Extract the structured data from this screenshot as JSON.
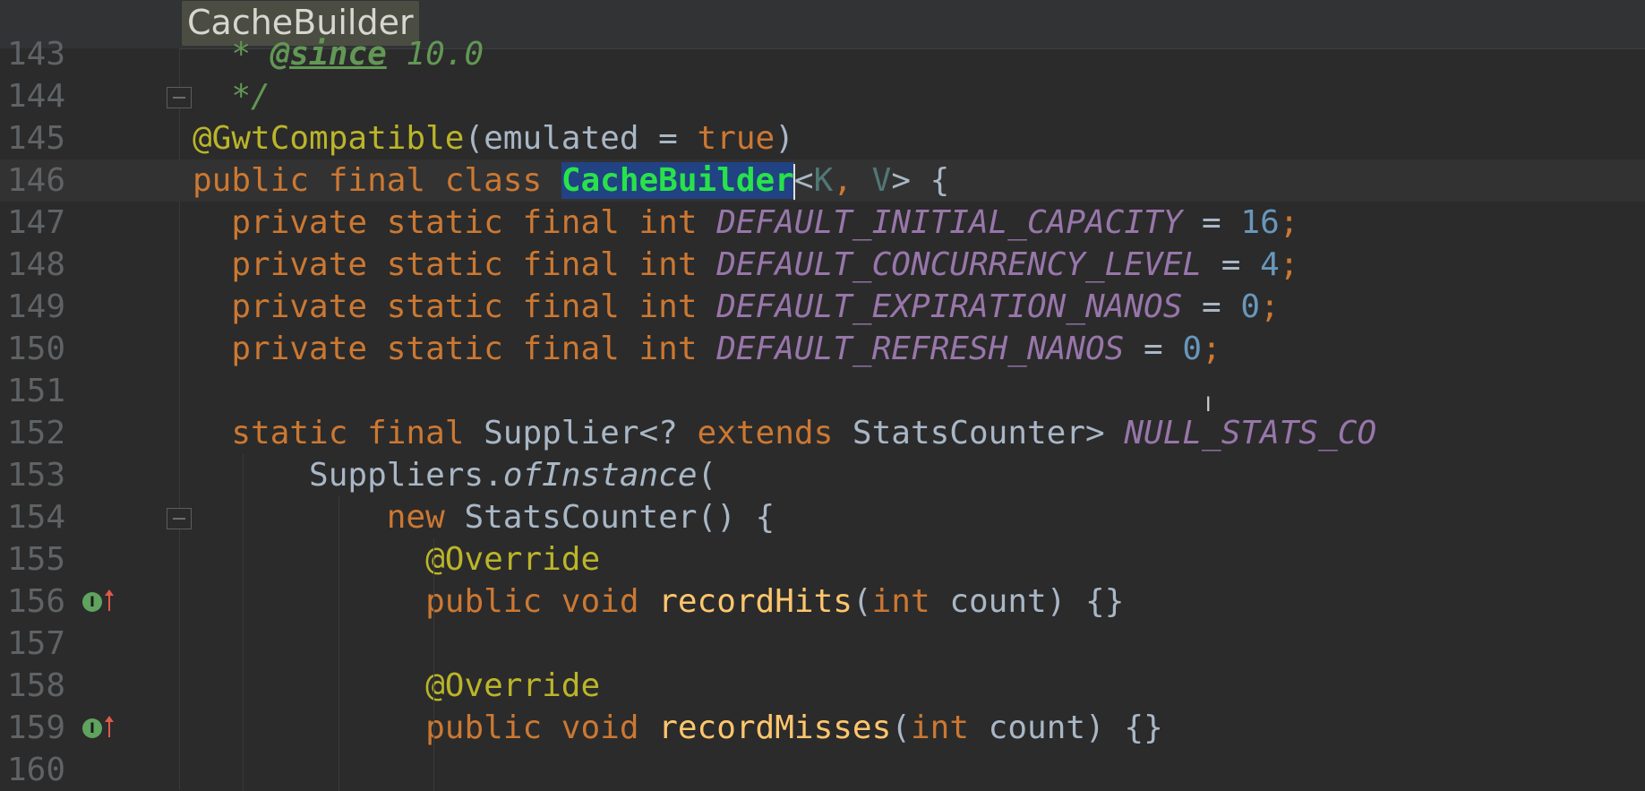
{
  "breadcrumb": {
    "label": "CacheBuilder"
  },
  "lines": [
    {
      "n": "143",
      "parts": [
        {
          "t": "  * ",
          "c": "cmt"
        },
        {
          "t": "@since",
          "c": "cmt-tag"
        },
        {
          "t": " 10.0",
          "c": "cmt"
        }
      ]
    },
    {
      "n": "144",
      "parts": [
        {
          "t": "  */",
          "c": "cmt"
        }
      ]
    },
    {
      "n": "145",
      "parts": [
        {
          "t": "@GwtCompatible",
          "c": "ann"
        },
        {
          "t": "(emulated = ",
          "c": ""
        },
        {
          "t": "true",
          "c": "kw"
        },
        {
          "t": ")",
          "c": ""
        }
      ]
    },
    {
      "n": "146",
      "parts": [
        {
          "t": "public final class ",
          "c": "kw"
        },
        {
          "t": "CacheBuilder",
          "c": "hl-cls"
        },
        {
          "t": "|",
          "c": "caret"
        },
        {
          "t": "<",
          "c": ""
        },
        {
          "t": "K",
          "c": "typeparam"
        },
        {
          "t": ", ",
          "c": "kw"
        },
        {
          "t": "V",
          "c": "typeparam"
        },
        {
          "t": "> {",
          "c": ""
        }
      ]
    },
    {
      "n": "147",
      "parts": [
        {
          "t": "  private static final int ",
          "c": "kw"
        },
        {
          "t": "DEFAULT_INITIAL_CAPACITY",
          "c": "fld"
        },
        {
          "t": " = ",
          "c": ""
        },
        {
          "t": "16",
          "c": "num"
        },
        {
          "t": ";",
          "c": "kw"
        }
      ]
    },
    {
      "n": "148",
      "parts": [
        {
          "t": "  private static final int ",
          "c": "kw"
        },
        {
          "t": "DEFAULT_CONCURRENCY_LEVEL",
          "c": "fld"
        },
        {
          "t": " = ",
          "c": ""
        },
        {
          "t": "4",
          "c": "num"
        },
        {
          "t": ";",
          "c": "kw"
        }
      ]
    },
    {
      "n": "149",
      "parts": [
        {
          "t": "  private static final int ",
          "c": "kw"
        },
        {
          "t": "DEFAULT_EXPIRATION_NANOS",
          "c": "fld"
        },
        {
          "t": " = ",
          "c": ""
        },
        {
          "t": "0",
          "c": "num"
        },
        {
          "t": ";",
          "c": "kw"
        }
      ]
    },
    {
      "n": "150",
      "parts": [
        {
          "t": "  private static final int ",
          "c": "kw"
        },
        {
          "t": "DEFAULT_REFRESH_NANOS",
          "c": "fld"
        },
        {
          "t": " = ",
          "c": ""
        },
        {
          "t": "0",
          "c": "num"
        },
        {
          "t": ";",
          "c": "kw"
        }
      ]
    },
    {
      "n": "151",
      "parts": []
    },
    {
      "n": "152",
      "parts": [
        {
          "t": "  static final ",
          "c": "kw"
        },
        {
          "t": "Supplier<? ",
          "c": ""
        },
        {
          "t": "extends ",
          "c": "kw"
        },
        {
          "t": "StatsCounter> ",
          "c": ""
        },
        {
          "t": "NULL_STATS_CO",
          "c": "fld"
        }
      ]
    },
    {
      "n": "153",
      "parts": [
        {
          "t": "      Suppliers.",
          "c": ""
        },
        {
          "t": "ofInstance",
          "c": "ital"
        },
        {
          "t": "(",
          "c": ""
        }
      ]
    },
    {
      "n": "154",
      "parts": [
        {
          "t": "          ",
          "c": ""
        },
        {
          "t": "new ",
          "c": "kw"
        },
        {
          "t": "StatsCounter() {",
          "c": ""
        }
      ]
    },
    {
      "n": "155",
      "parts": [
        {
          "t": "            ",
          "c": ""
        },
        {
          "t": "@Override",
          "c": "ann"
        }
      ]
    },
    {
      "n": "156",
      "parts": [
        {
          "t": "            ",
          "c": ""
        },
        {
          "t": "public void ",
          "c": "kw"
        },
        {
          "t": "recordHits",
          "c": "mth"
        },
        {
          "t": "(",
          "c": ""
        },
        {
          "t": "int ",
          "c": "kw"
        },
        {
          "t": "count) {}",
          "c": ""
        }
      ]
    },
    {
      "n": "157",
      "parts": []
    },
    {
      "n": "158",
      "parts": [
        {
          "t": "            ",
          "c": ""
        },
        {
          "t": "@Override",
          "c": "ann"
        }
      ]
    },
    {
      "n": "159",
      "parts": [
        {
          "t": "            ",
          "c": ""
        },
        {
          "t": "public void ",
          "c": "kw"
        },
        {
          "t": "recordMisses",
          "c": "mth"
        },
        {
          "t": "(",
          "c": ""
        },
        {
          "t": "int ",
          "c": "kw"
        },
        {
          "t": "count) {}",
          "c": ""
        }
      ]
    },
    {
      "n": "160",
      "parts": []
    }
  ],
  "gutter_icons": {
    "implements_icon": "implements-method-icon",
    "fold_icon": "fold-marker-icon",
    "impl_letter": "I"
  },
  "colors": {
    "background": "#2b2b2b",
    "keyword": "#cc7832",
    "field": "#9876aa",
    "number": "#6897bb",
    "annotation": "#bbb529",
    "method": "#ffc66d",
    "comment": "#629755"
  }
}
